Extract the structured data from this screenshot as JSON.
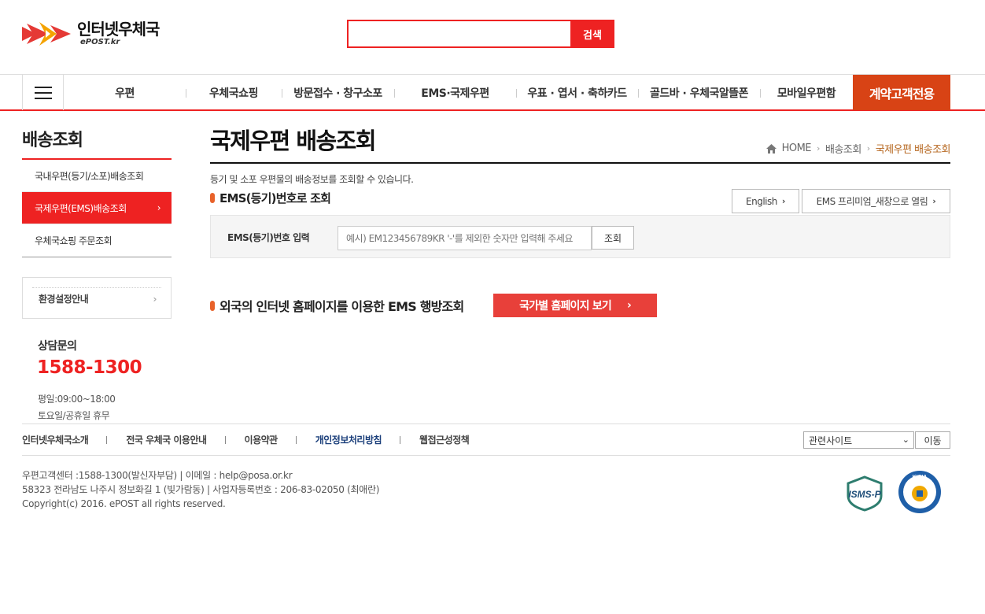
{
  "header": {
    "logo_title": "인터넷우체국",
    "logo_sub": "ePOST.kr",
    "search_placeholder": "",
    "search_button": "검색"
  },
  "gnb": {
    "items": [
      "우편",
      "우체국쇼핑",
      "방문접수 · 창구소포",
      "EMS·국제우편",
      "우표 · 엽서 · 축하카드",
      "골드바 · 우체국알뜰폰",
      "모바일우편함"
    ],
    "special": "계약고객전용"
  },
  "sidebar": {
    "title": "배송조회",
    "items": [
      {
        "label": "국내우편(등기/소포)배송조회"
      },
      {
        "label": "국제우편(EMS)배송조회"
      },
      {
        "label": "우체국쇼핑 주문조회"
      }
    ],
    "env_label": "환경설정안내",
    "contact_label": "상담문의",
    "contact_phone": "1588-1300",
    "hours_weekday": "평일:09:00~18:00",
    "hours_weekend": "토요일/공휴일 휴무"
  },
  "content": {
    "page_title": "국제우편 배송조회",
    "breadcrumb": [
      "HOME",
      "배송조회",
      "국제우편 배송조회"
    ],
    "description": "등기 및 소포 우편물의 배송정보를 조회할 수 있습니다.",
    "section_title": "EMS(등기)번호로 조회",
    "english_button": "English",
    "premium_button": "EMS 프리미엄_새창으로 열림",
    "input_label": "EMS(등기)번호 입력",
    "input_placeholder": "예시) EM123456789KR '-'를 제외한 숫자만 입력해 주세요",
    "query_button": "조회",
    "intl_title": "외국의 인터넷 홈페이지를 이용한 EMS 행방조회",
    "country_button": "국가별 홈페이지 보기"
  },
  "footer": {
    "links": [
      "인터넷우체국소개",
      "전국 우체국 이용안내",
      "이용약관",
      "개인정보처리방침",
      "웹접근성정책"
    ],
    "family_select": "관련사이트",
    "family_go": "이동",
    "info_line1": "우편고객센터 :1588-1300(발신자부담)   |   이메일 : help@posa.or.kr",
    "info_line2": "58323 전라남도 나주시 정보화길 1 (빛가람동)   |   사업자등록번호 : 206-83-02050 (최애란)",
    "copyright": "Copyright(c) 2016. ePOST all rights reserved.",
    "cert1_text": "ISMS-P",
    "cert2_text": "KISIA"
  },
  "colors": {
    "accent_red": "#ee2222",
    "special_orange": "#d84315",
    "breadcrumb_current": "#b5651d",
    "country_button": "#e8403a"
  }
}
